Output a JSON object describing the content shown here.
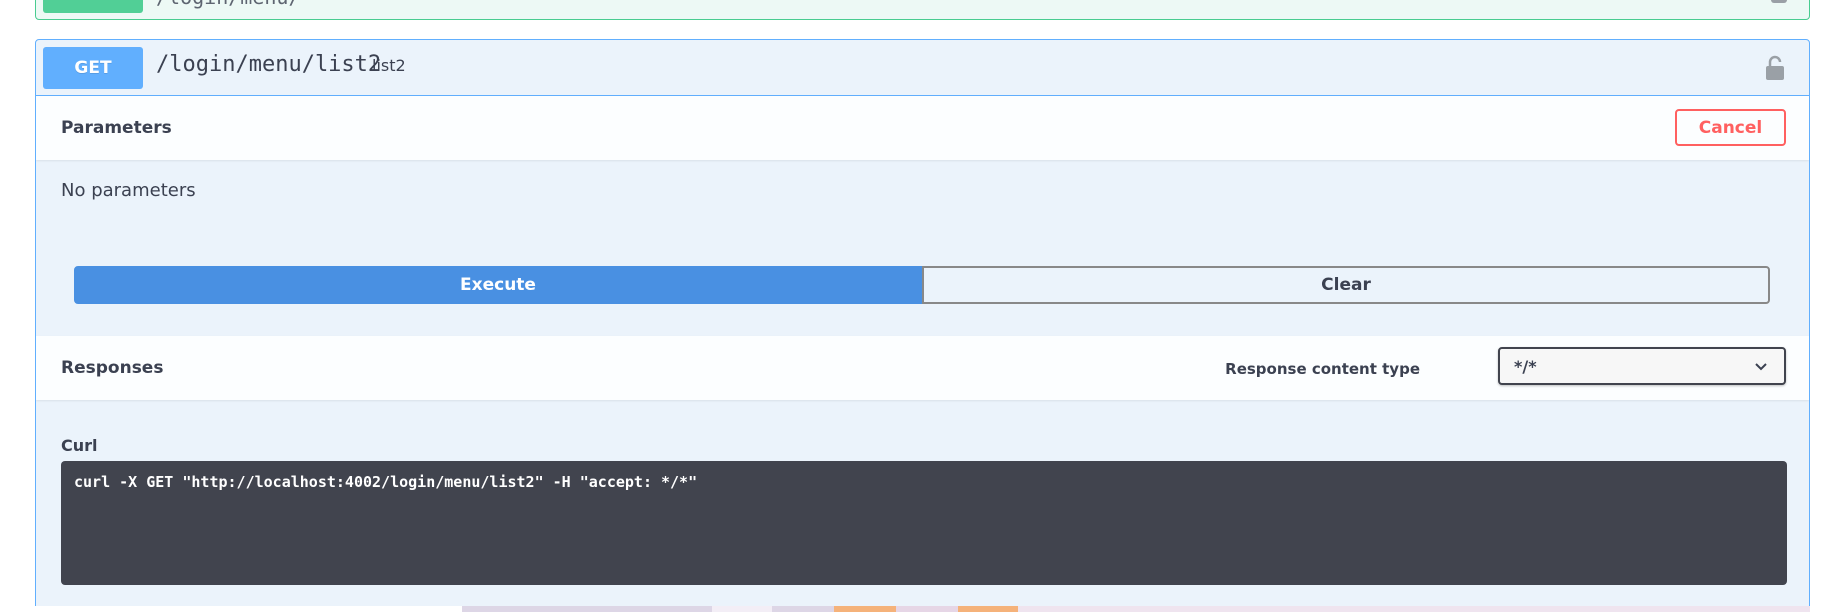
{
  "previous_op": {
    "path_fragment": "/login/menu/"
  },
  "operation": {
    "method": "GET",
    "path": "/login/menu/list2",
    "description": "list2"
  },
  "parameters": {
    "title": "Parameters",
    "cancel_label": "Cancel",
    "empty_text": "No parameters"
  },
  "actions": {
    "execute_label": "Execute",
    "clear_label": "Clear"
  },
  "responses": {
    "title": "Responses",
    "content_type_label": "Response content type",
    "content_type_value": "*/*"
  },
  "curl": {
    "label": "Curl",
    "command": "curl -X GET \"http://localhost:4002/login/menu/list2\" -H \"accept: */*\""
  },
  "colors": {
    "get": "#61affe",
    "post": "#49cc90",
    "execute": "#4990e2",
    "cancel": "#ff6060",
    "code_bg": "#41444e"
  },
  "icons": {
    "lock": "lock-icon",
    "chevron": "chevron-down-icon"
  }
}
